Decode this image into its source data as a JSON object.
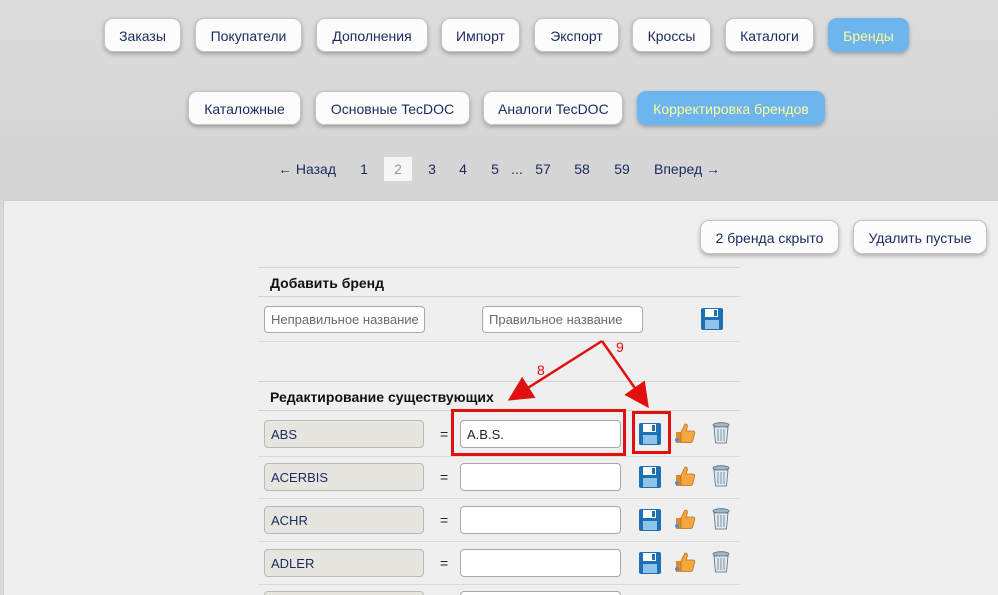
{
  "nav": {
    "main_tabs": [
      "Заказы",
      "Покупатели",
      "Дополнения",
      "Импорт",
      "Экспорт",
      "Кроссы",
      "Каталоги",
      "Бренды"
    ],
    "active_main": "Бренды",
    "sub_tabs": [
      "Каталожные",
      "Основные TecDOC",
      "Аналоги TecDOC",
      "Корректировка брендов"
    ],
    "active_sub": "Корректировка брендов"
  },
  "pager": {
    "prev": "← Назад",
    "pages": [
      "1",
      "2",
      "3",
      "4",
      "5"
    ],
    "ellipsis": "...",
    "tail_pages": [
      "57",
      "58",
      "59"
    ],
    "current": "2",
    "next": "Вперед →"
  },
  "actions": {
    "hidden_label": "2 бренда скрыто",
    "delete_empty_label": "Удалить пустые"
  },
  "add_brand": {
    "title": "Добавить бренд",
    "wrong_placeholder": "Неправильное название",
    "correct_placeholder": "Правильное название"
  },
  "edit": {
    "title": "Редактирование существующих",
    "equals": "=",
    "rows": [
      {
        "brand": "ABS",
        "value": "A.B.S."
      },
      {
        "brand": "ACERBIS",
        "value": ""
      },
      {
        "brand": "ACHR",
        "value": ""
      },
      {
        "brand": "ADLER",
        "value": ""
      }
    ]
  },
  "annotations": {
    "label_8": "8",
    "label_9": "9",
    "color": "#e01010"
  },
  "colors": {
    "active_tab_bg": "#6db5ee",
    "active_tab_text": "#fffa9a",
    "text": "#1a2a5e"
  },
  "icons": [
    "save-icon",
    "thumbs-up-icon",
    "trash-icon"
  ]
}
